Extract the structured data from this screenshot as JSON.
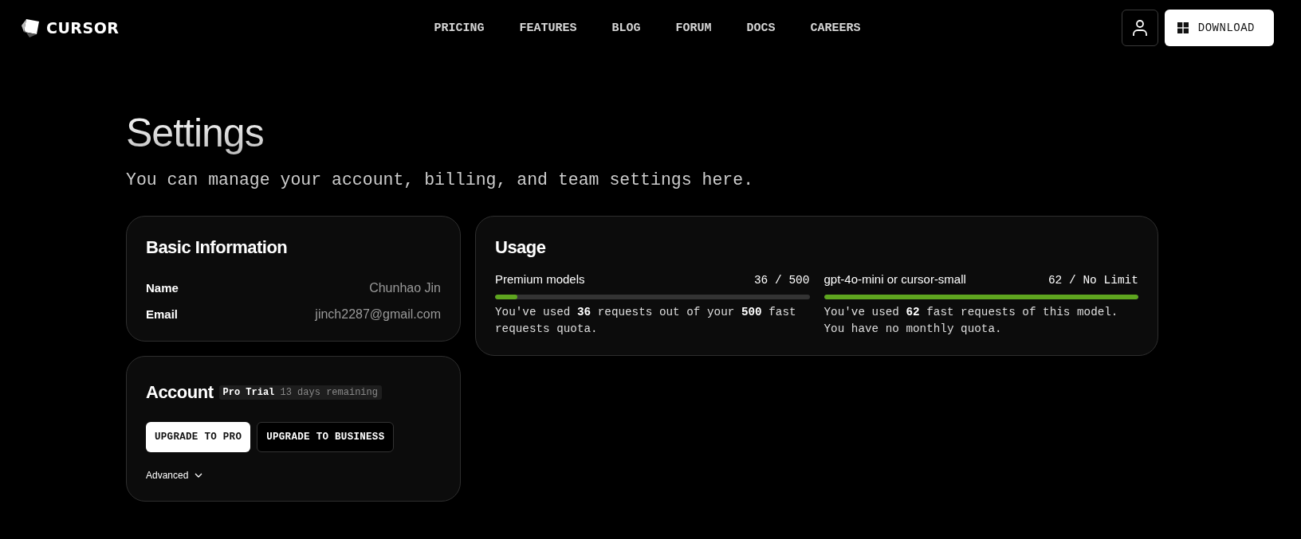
{
  "header": {
    "logo": "CURSOR",
    "nav": [
      "PRICING",
      "FEATURES",
      "BLOG",
      "FORUM",
      "DOCS",
      "CAREERS"
    ],
    "download": "DOWNLOAD"
  },
  "page": {
    "title": "Settings",
    "subtitle": "You can manage your account, billing, and team settings here."
  },
  "basic_information": {
    "title": "Basic Information",
    "fields": [
      {
        "label": "Name",
        "value": "Chunhao Jin"
      },
      {
        "label": "Email",
        "value": "jinch2287@gmail.com"
      }
    ]
  },
  "account": {
    "title": "Account",
    "plan": "Pro Trial",
    "remaining": "13 days remaining",
    "buttons": [
      {
        "label": "UPGRADE TO PRO",
        "kind": "primary"
      },
      {
        "label": "UPGRADE TO BUSINESS",
        "kind": "secondary"
      }
    ],
    "advanced": "Advanced"
  },
  "usage": {
    "title": "Usage",
    "meters": [
      {
        "name": "Premium models",
        "reading": "36 / 500",
        "level": 0.072,
        "description": "You've used **36** requests out of your **500** fast requests quota."
      },
      {
        "name": "gpt-4o-mini or cursor-small",
        "reading": "62 / No Limit",
        "level": 1,
        "description": "You've used **62** fast requests of this model. You have no monthly quota."
      }
    ]
  }
}
